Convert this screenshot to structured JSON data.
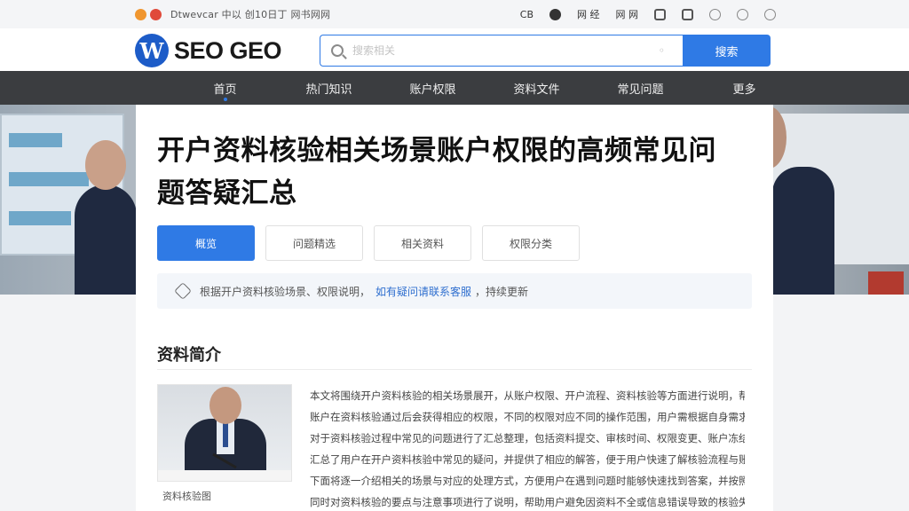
{
  "status_bar": {
    "text": "Dtwevcar 中以 创10日丁 网书网网",
    "right_items": [
      "CB",
      "",
      "网 经",
      "网 网",
      "",
      "",
      "",
      ""
    ]
  },
  "header": {
    "logo_text": "SEO GEO",
    "logo_mark": "W",
    "search_placeholder": "搜索相关",
    "search_button": "搜索"
  },
  "nav": {
    "items": [
      "首页",
      "热门知识",
      "账户权限",
      "资料文件",
      "常见问题",
      "更多"
    ]
  },
  "article": {
    "title": "开户资料核验相关场景账户权限的高频常见问题答疑汇总",
    "tabs": [
      "概览",
      "问题精选",
      "相关资料",
      "权限分类"
    ],
    "notice": {
      "text": "根据开户资料核验场景、权限说明，",
      "link": "如有疑问请联系客服",
      "tail": "，持续更新"
    },
    "section_title": "资料简介",
    "thumb_caption": "资料核验图",
    "paragraphs": [
      "本文将围绕开户资料核验的相关场景展开，从账户权限、开户流程、资料核验等方面进行说明，帮助用户理解相关问题",
      "账户在资料核验通过后会获得相应的权限，不同的权限对应不同的操作范围，用户需根据自身需求申请对应的账户权限",
      "对于资料核验过程中常见的问题进行了汇总整理，包括资料提交、审核时间、权限变更、账户冻结等多种场景的说明",
      "汇总了用户在开户资料核验中常见的疑问，并提供了相应的解答，便于用户快速了解核验流程与账户权限的相关规则",
      "下面将逐一介绍相关的场景与对应的处理方式，方便用户在遇到问题时能够快速找到答案，并按照指引完成相关操作",
      "同时对资料核验的要点与注意事项进行了说明，帮助用户避免因资料不全或信息错误导致的核验失败与权限受限问题"
    ]
  },
  "colors": {
    "accent": "#2f7ae5",
    "nav_bg": "#3b3d40",
    "logo_blue": "#1d5cc8"
  }
}
